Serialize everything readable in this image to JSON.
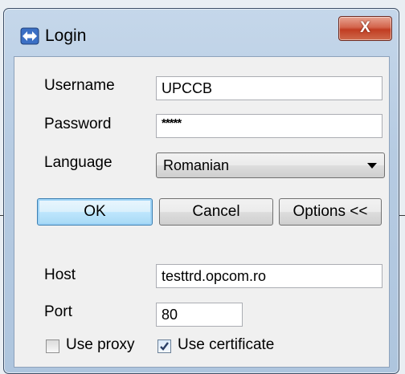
{
  "window": {
    "title": "Login",
    "close_label": "X"
  },
  "form": {
    "username": {
      "label": "Username",
      "value": "UPCCB"
    },
    "password": {
      "label": "Password",
      "value": "*****"
    },
    "language": {
      "label": "Language",
      "selected": "Romanian"
    },
    "host": {
      "label": "Host",
      "value": "testtrd.opcom.ro"
    },
    "port": {
      "label": "Port",
      "value": "80"
    }
  },
  "buttons": {
    "ok": "OK",
    "cancel": "Cancel",
    "options": "Options <<"
  },
  "checkboxes": {
    "use_proxy": {
      "label": "Use proxy",
      "checked": false
    },
    "use_certificate": {
      "label": "Use certificate",
      "checked": true
    }
  },
  "icons": {
    "title_icon": "arrows-exchange-icon"
  },
  "colors": {
    "title_bar": "#b6cbe2",
    "close_button": "#c13d22",
    "client_bg": "#f0f0f0"
  }
}
